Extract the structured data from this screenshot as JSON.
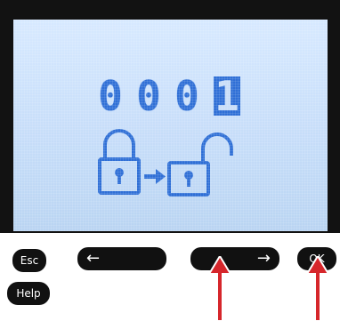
{
  "screen": {
    "code_digits": [
      "0",
      "0",
      "0",
      "1"
    ],
    "active_digit_index": 3,
    "lock_icons": [
      "padlock-closed-icon",
      "arrow-right-icon",
      "padlock-open-icon"
    ]
  },
  "buttons": {
    "esc_label": "Esc",
    "help_label": "Help",
    "left_arrow": "←",
    "right_arrow": "→",
    "ok_label": "OK"
  },
  "indicators": {
    "pointers": [
      "right-button",
      "ok-button"
    ],
    "color": "#d6262b"
  },
  "colors": {
    "lcd_background": "#c6ddf9",
    "lcd_foreground": "#2f6fd6",
    "button": "#111111"
  }
}
